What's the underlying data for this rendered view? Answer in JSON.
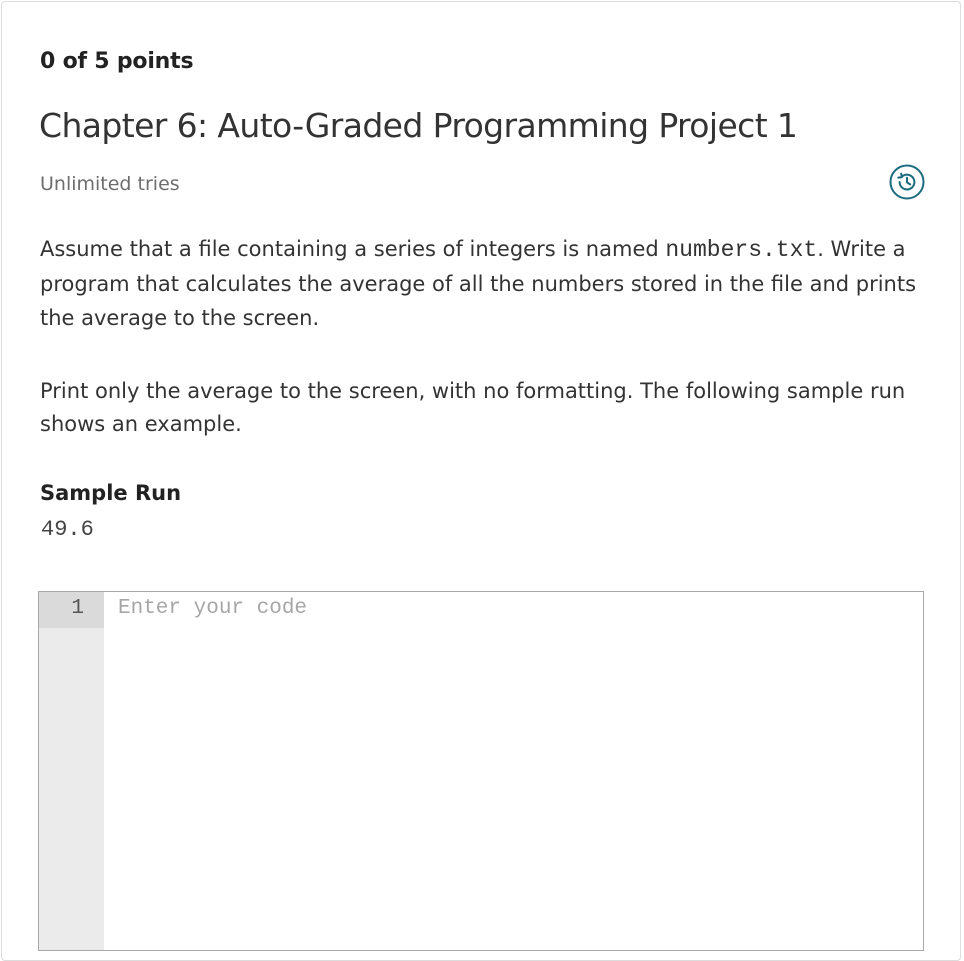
{
  "question": {
    "points": "0 of 5 points",
    "title": "Chapter 6: Auto-Graded Programming Project 1",
    "tries": "Unlimited tries",
    "history_icon": "history-icon",
    "accent_color": "#1d6b80"
  },
  "prompt": {
    "para1_before": "Assume that a file containing a series of integers is named ",
    "para1_code": "numbers.txt",
    "para1_after": ". Write a program that calculates the average of all the numbers stored in the file and prints the average to the screen.",
    "para2": "Print only the average to the screen, with no formatting. The following sample run shows an example."
  },
  "sample": {
    "heading": "Sample Run",
    "output": "49.6"
  },
  "editor": {
    "line_number": "1",
    "placeholder": "Enter your code",
    "value": ""
  }
}
